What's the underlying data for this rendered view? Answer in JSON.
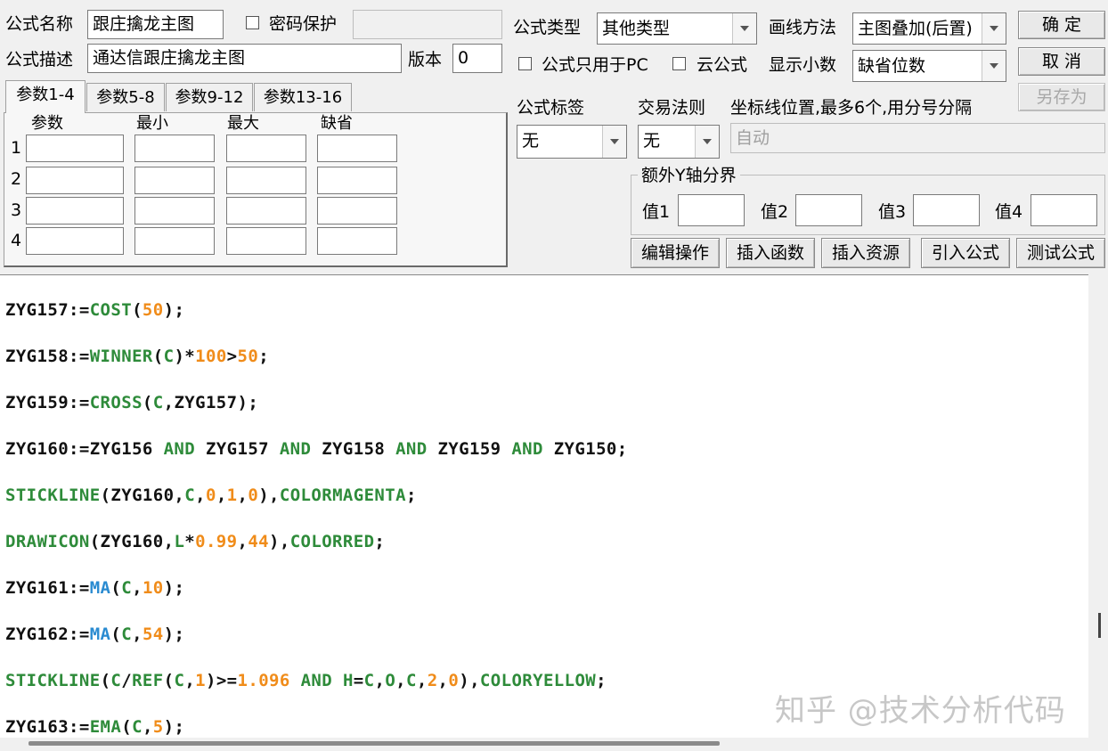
{
  "form": {
    "name_label": "公式名称",
    "name_value": "跟庄擒龙主图",
    "password_label": "密码保护",
    "password_value": "",
    "desc_label": "公式描述",
    "desc_value": "通达信跟庄擒龙主图",
    "version_label": "版本",
    "version_value": "0",
    "type_label": "公式类型",
    "type_value": "其他类型",
    "draw_label": "画线方法",
    "draw_value": "主图叠加(后置)",
    "pc_only_label": "公式只用于PC",
    "cloud_label": "云公式",
    "decimals_label": "显示小数",
    "decimals_value": "缺省位数",
    "tag_label": "公式标签",
    "tag_value": "无",
    "trade_label": "交易法则",
    "trade_value": "无",
    "coord_label": "坐标线位置,最多6个,用分号分隔",
    "coord_value": "自动",
    "yaxis_label": "额外Y轴分界",
    "y1_label": "值1",
    "y2_label": "值2",
    "y3_label": "值3",
    "y4_label": "值4"
  },
  "buttons": {
    "ok": "确  定",
    "cancel": "取  消",
    "save_as": "另存为",
    "edit_ops": "编辑操作",
    "insert_func": "插入函数",
    "insert_res": "插入资源",
    "import_formula": "引入公式",
    "test_formula": "测试公式"
  },
  "tabs": [
    "参数1-4",
    "参数5-8",
    "参数9-12",
    "参数13-16"
  ],
  "param_headers": [
    "参数",
    "最小",
    "最大",
    "缺省"
  ],
  "param_rows": [
    "1",
    "2",
    "3",
    "4"
  ],
  "code": [
    [
      [
        "ZYG157:=",
        "t"
      ],
      [
        "COST",
        "k"
      ],
      [
        "(",
        "t"
      ],
      [
        "50",
        "n"
      ],
      [
        ");",
        "t"
      ]
    ],
    [
      [
        "ZYG158:=",
        "t"
      ],
      [
        "WINNER",
        "k"
      ],
      [
        "(",
        "t"
      ],
      [
        "C",
        "k"
      ],
      [
        ")*",
        "t"
      ],
      [
        "100",
        "n"
      ],
      [
        ">",
        "t"
      ],
      [
        "50",
        "n"
      ],
      [
        ";",
        "t"
      ]
    ],
    [
      [
        "ZYG159:=",
        "t"
      ],
      [
        "CROSS",
        "k"
      ],
      [
        "(",
        "t"
      ],
      [
        "C",
        "k"
      ],
      [
        ",ZYG157);",
        "t"
      ]
    ],
    [
      [
        "ZYG160:=ZYG156 ",
        "t"
      ],
      [
        "AND",
        "k"
      ],
      [
        " ZYG157 ",
        "t"
      ],
      [
        "AND",
        "k"
      ],
      [
        " ZYG158 ",
        "t"
      ],
      [
        "AND",
        "k"
      ],
      [
        " ZYG159 ",
        "t"
      ],
      [
        "AND",
        "k"
      ],
      [
        " ZYG150;",
        "t"
      ]
    ],
    [
      [
        "STICKLINE",
        "k"
      ],
      [
        "(ZYG160,",
        "t"
      ],
      [
        "C",
        "k"
      ],
      [
        ",",
        "t"
      ],
      [
        "0",
        "n"
      ],
      [
        ",",
        "t"
      ],
      [
        "1",
        "n"
      ],
      [
        ",",
        "t"
      ],
      [
        "0",
        "n"
      ],
      [
        "),",
        "t"
      ],
      [
        "COLORMAGENTA",
        "k"
      ],
      [
        ";",
        "t"
      ]
    ],
    [
      [
        "DRAWICON",
        "k"
      ],
      [
        "(ZYG160,",
        "t"
      ],
      [
        "L",
        "k"
      ],
      [
        "*",
        "t"
      ],
      [
        "0.99",
        "n"
      ],
      [
        ",",
        "t"
      ],
      [
        "44",
        "n"
      ],
      [
        "),",
        "t"
      ],
      [
        "COLORRED",
        "k"
      ],
      [
        ";",
        "t"
      ]
    ],
    [
      [
        "ZYG161:=",
        "t"
      ],
      [
        "MA",
        "f"
      ],
      [
        "(",
        "t"
      ],
      [
        "C",
        "k"
      ],
      [
        ",",
        "t"
      ],
      [
        "10",
        "n"
      ],
      [
        ");",
        "t"
      ]
    ],
    [
      [
        "ZYG162:=",
        "t"
      ],
      [
        "MA",
        "f"
      ],
      [
        "(",
        "t"
      ],
      [
        "C",
        "k"
      ],
      [
        ",",
        "t"
      ],
      [
        "54",
        "n"
      ],
      [
        ");",
        "t"
      ]
    ],
    [
      [
        "STICKLINE",
        "k"
      ],
      [
        "(",
        "t"
      ],
      [
        "C",
        "k"
      ],
      [
        "/",
        "t"
      ],
      [
        "REF",
        "k"
      ],
      [
        "(",
        "t"
      ],
      [
        "C",
        "k"
      ],
      [
        ",",
        "t"
      ],
      [
        "1",
        "n"
      ],
      [
        ")>=",
        "t"
      ],
      [
        "1.096",
        "n"
      ],
      [
        " ",
        "t"
      ],
      [
        "AND",
        "k"
      ],
      [
        " ",
        "t"
      ],
      [
        "H",
        "k"
      ],
      [
        "=",
        "t"
      ],
      [
        "C",
        "k"
      ],
      [
        ",",
        "t"
      ],
      [
        "O",
        "k"
      ],
      [
        ",",
        "t"
      ],
      [
        "C",
        "k"
      ],
      [
        ",",
        "t"
      ],
      [
        "2",
        "n"
      ],
      [
        ",",
        "t"
      ],
      [
        "0",
        "n"
      ],
      [
        "),",
        "t"
      ],
      [
        "COLORYELLOW",
        "k"
      ],
      [
        ";",
        "t"
      ]
    ],
    [
      [
        "ZYG163:=",
        "t"
      ],
      [
        "EMA",
        "k"
      ],
      [
        "(",
        "t"
      ],
      [
        "C",
        "k"
      ],
      [
        ",",
        "t"
      ],
      [
        "5",
        "n"
      ],
      [
        ");",
        "t"
      ]
    ]
  ],
  "watermark": "知乎 @技术分析代码"
}
